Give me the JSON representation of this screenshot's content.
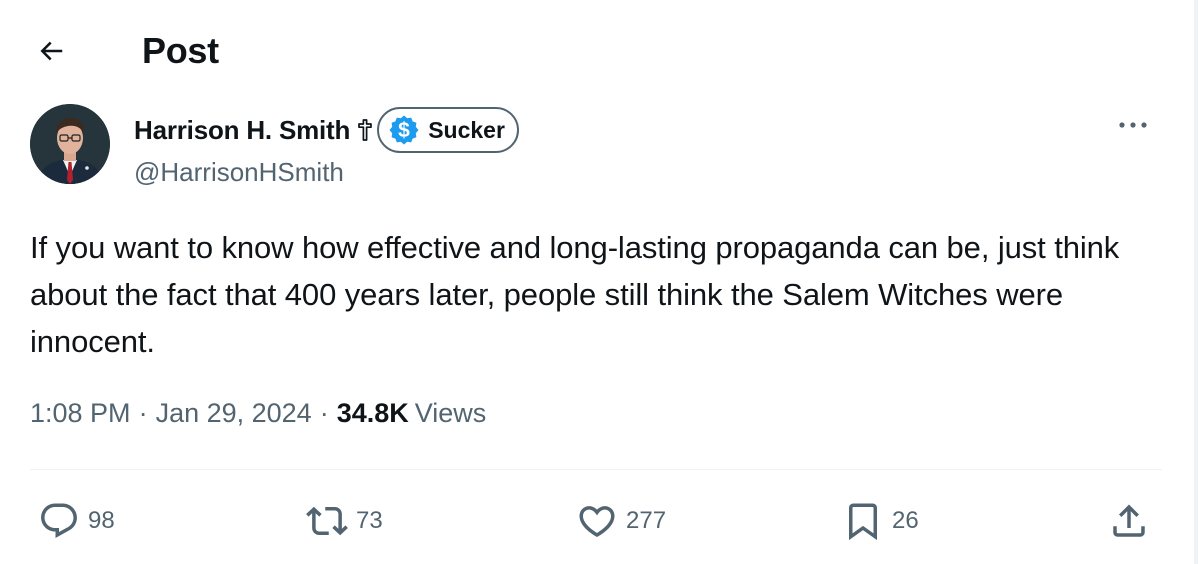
{
  "header": {
    "title": "Post",
    "back_icon": "arrow-left-icon"
  },
  "author": {
    "display_name": "Harrison H. Smith",
    "name_emoji": "✟",
    "badge": {
      "icon": "dollar-sign-icon",
      "label": "Sucker",
      "icon_color": "#1d9bf0"
    },
    "handle": "@HarrisonHSmith"
  },
  "tweet": {
    "text": "If you want to know how effective and long-lasting propaganda can be, just think about the fact that 400 years later, people still think the Salem Witches were innocent."
  },
  "meta": {
    "time": "1:08 PM",
    "separator": "·",
    "date": "Jan 29, 2024",
    "views_count": "34.8K",
    "views_label": "Views"
  },
  "actions": {
    "reply": {
      "icon": "reply-icon",
      "count": "98"
    },
    "repost": {
      "icon": "repost-icon",
      "count": "73"
    },
    "like": {
      "icon": "heart-icon",
      "count": "277"
    },
    "bookmark": {
      "icon": "bookmark-icon",
      "count": "26"
    },
    "share": {
      "icon": "share-icon"
    }
  },
  "colors": {
    "text_primary": "#0f1419",
    "text_secondary": "#536471",
    "divider": "#eff3f4",
    "accent": "#1d9bf0"
  }
}
